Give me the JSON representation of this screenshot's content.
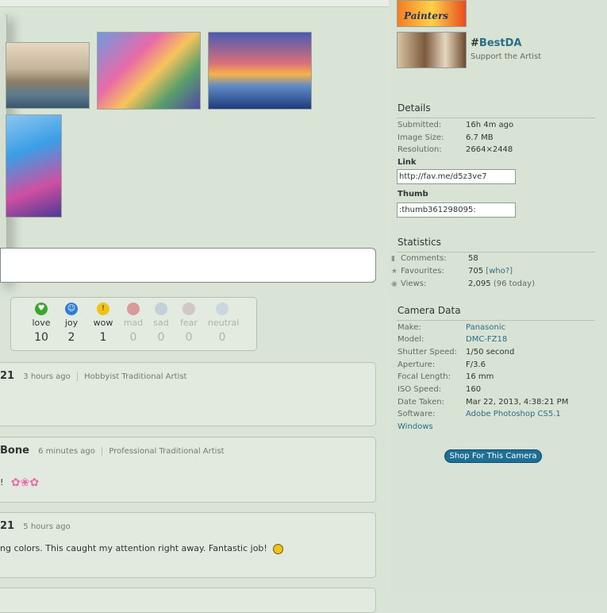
{
  "moods": [
    {
      "label": "love",
      "count": "10",
      "color": "#3aa62e",
      "glyph": "♥",
      "active": true
    },
    {
      "label": "joy",
      "count": "2",
      "color": "#2f7bd8",
      "glyph": "☺",
      "active": true
    },
    {
      "label": "wow",
      "count": "1",
      "color": "#f1c21a",
      "glyph": "!",
      "active": true
    },
    {
      "label": "mad",
      "count": "0",
      "color": "#d99a9a",
      "glyph": "",
      "active": false
    },
    {
      "label": "sad",
      "count": "0",
      "color": "#c3cfd9",
      "glyph": "",
      "active": false
    },
    {
      "label": "fear",
      "count": "0",
      "color": "#d2c6c6",
      "glyph": "",
      "active": false
    },
    {
      "label": "neutral",
      "count": "0",
      "color": "#cbd7e0",
      "glyph": "",
      "active": false
    }
  ],
  "comments": [
    {
      "user": "21",
      "time": "3 hours ago",
      "role": "Hobbyist Traditional Artist",
      "body": ""
    },
    {
      "user": "Bone",
      "time": "6 minutes ago",
      "role": "Professional Traditional Artist",
      "body": "!"
    },
    {
      "user": "21",
      "time": "5 hours ago",
      "role": "",
      "body": "ng colors. This caught my attention right away. Fantastic job!"
    }
  ],
  "sidebar": {
    "promo": {
      "text": "Painters"
    },
    "bestda": {
      "hash": "#",
      "tag": "BestDA",
      "sub": "Support the Artist"
    },
    "details": {
      "title": "Details",
      "rows": [
        {
          "label": "Submitted:",
          "value": "16h 4m ago"
        },
        {
          "label": "Image Size:",
          "value": "6.7 MB"
        },
        {
          "label": "Resolution:",
          "value": "2664×2448"
        }
      ],
      "link_label": "Link",
      "link_value": "http://fav.me/d5z3ve7",
      "thumb_label": "Thumb",
      "thumb_value": ":thumb361298095:"
    },
    "statistics": {
      "title": "Statistics",
      "comments_label": "Comments:",
      "comments_value": "58",
      "favourites_label": "Favourites:",
      "favourites_value": "705",
      "favourites_open": "[",
      "favourites_who": "who?",
      "favourites_close": "]",
      "views_label": "Views:",
      "views_value": "2,095",
      "views_today": "(96 today)"
    },
    "camera": {
      "title": "Camera Data",
      "rows": [
        {
          "label": "Make:",
          "value": "Panasonic",
          "link": true
        },
        {
          "label": "Model:",
          "value": "DMC-FZ18",
          "link": true
        },
        {
          "label": "Shutter Speed:",
          "value": "1/50 second",
          "link": false
        },
        {
          "label": "Aperture:",
          "value": "F/3.6",
          "link": false
        },
        {
          "label": "Focal Length:",
          "value": "16 mm",
          "link": false
        },
        {
          "label": "ISO Speed:",
          "value": "160",
          "link": false
        },
        {
          "label": "Date Taken:",
          "value": "Mar 22, 2013, 4:38:21 PM",
          "link": false
        },
        {
          "label": "Software:",
          "value": "Adobe Photoshop CS5.1",
          "link": true
        }
      ],
      "software_extra": "Windows",
      "shop_button": "Shop For This Camera"
    }
  }
}
